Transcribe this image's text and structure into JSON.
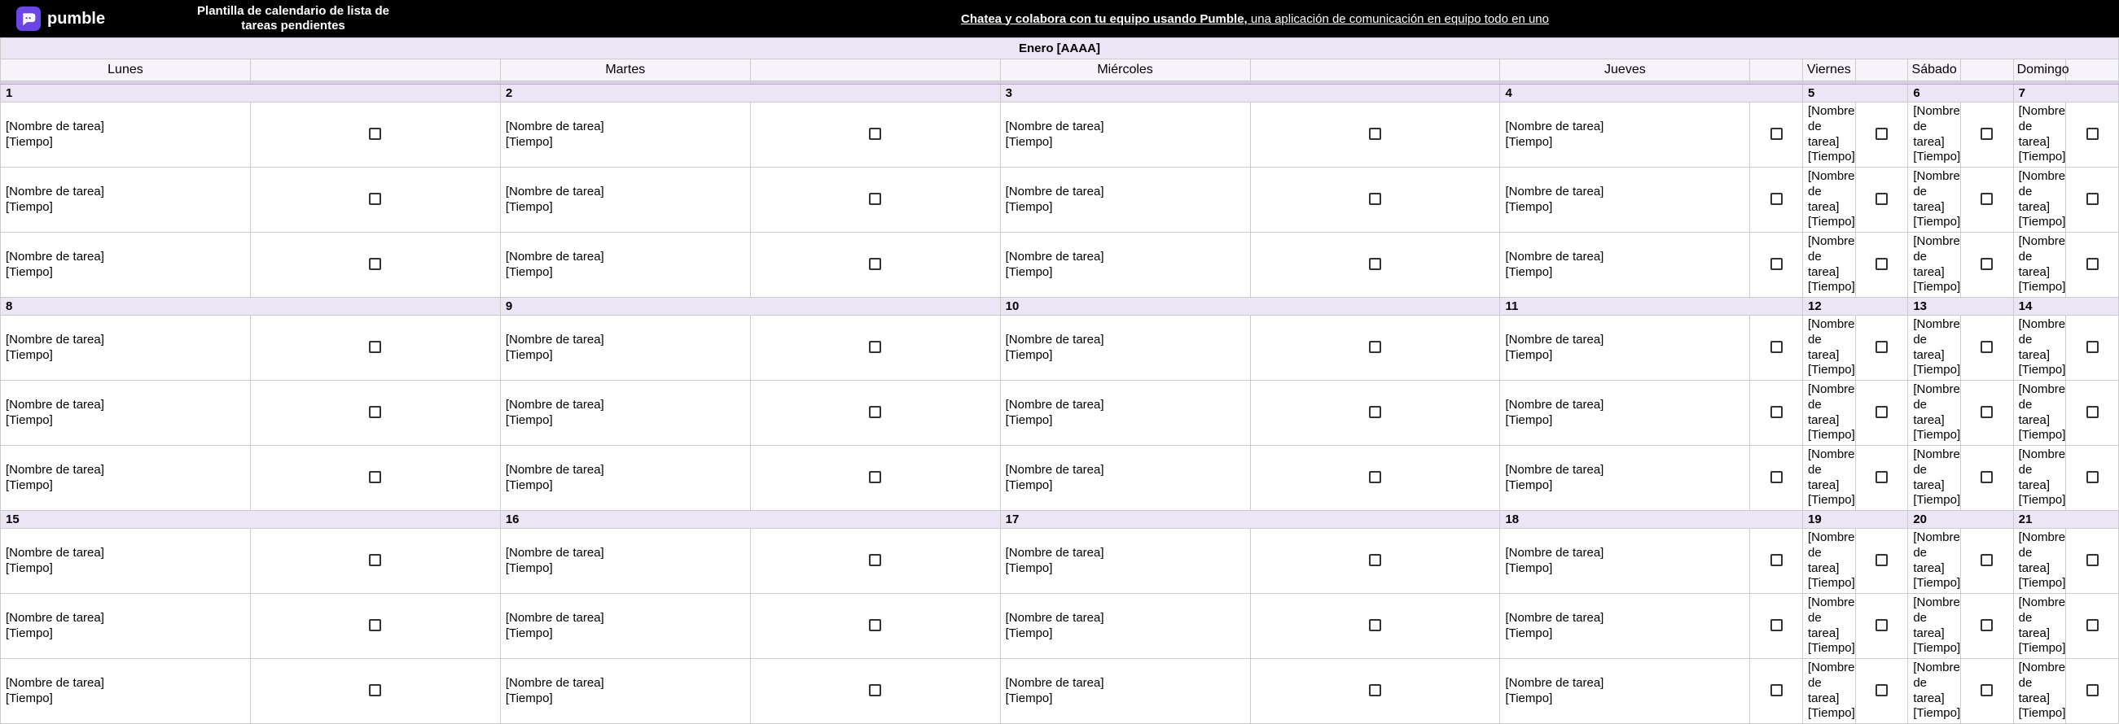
{
  "header": {
    "brand": "pumble",
    "template_title": "Plantilla de calendario de lista de tareas pendientes",
    "tagline_bold": "Chatea y colabora con tu equipo usando Pumble,",
    "tagline_rest": " una aplicación de comunicación en equipo todo en uno"
  },
  "calendar": {
    "month_label": "Enero [AAAA]",
    "weekdays": [
      "Lunes",
      "Martes",
      "Miércoles",
      "Jueves",
      "Viernes",
      "Sábado",
      "Domingo"
    ],
    "task_placeholder_line1": "[Nombre de tarea]",
    "task_placeholder_line2": "[Tiempo]",
    "weeks": [
      {
        "dates": [
          "1",
          "2",
          "3",
          "4",
          "5",
          "6",
          "7"
        ]
      },
      {
        "dates": [
          "8",
          "9",
          "10",
          "11",
          "12",
          "13",
          "14"
        ]
      },
      {
        "dates": [
          "15",
          "16",
          "17",
          "18",
          "19",
          "20",
          "21"
        ]
      }
    ],
    "tasks_per_day": 3
  }
}
